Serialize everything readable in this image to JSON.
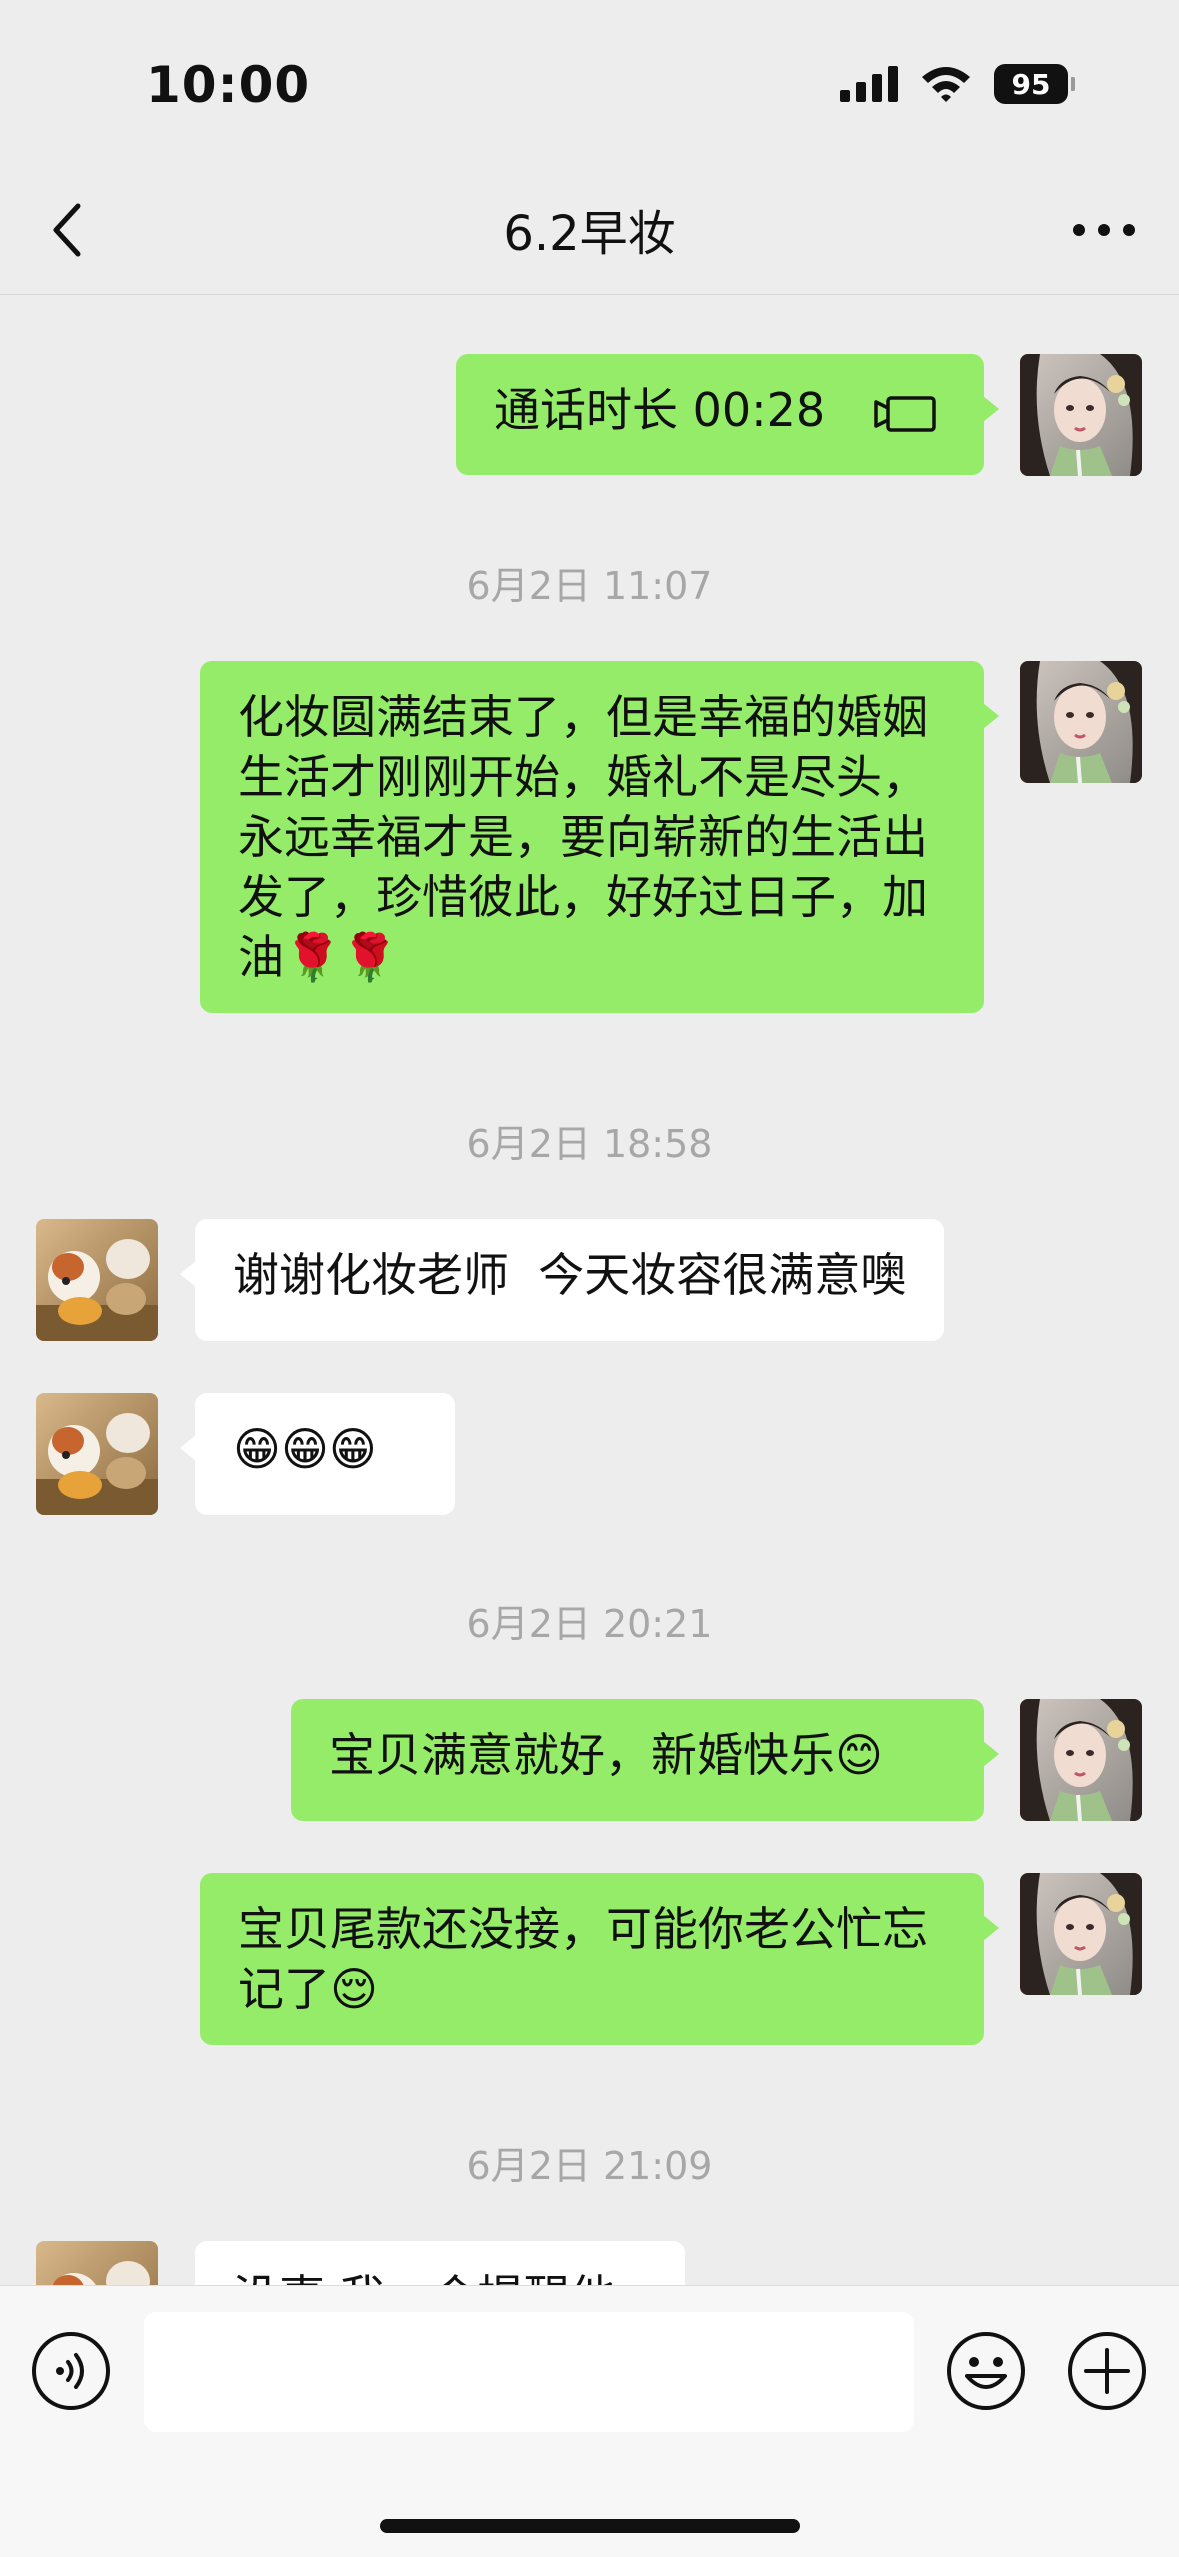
{
  "status_bar": {
    "time": "10:00",
    "battery_level": "95"
  },
  "header": {
    "title": "6.2早妆"
  },
  "messages": [
    {
      "type": "call",
      "sender": "me",
      "text": "通话时长 00:28"
    },
    {
      "type": "timestamp",
      "text": "6月2日 11:07"
    },
    {
      "type": "text",
      "sender": "me",
      "text": "化妆圆满结束了，但是幸福的婚姻生活才刚刚开始，婚礼不是尽头，永远幸福才是，要向崭新的生活出发了，珍惜彼此，好好过日子，加油🌹🌹"
    },
    {
      "type": "timestamp",
      "text": "6月2日 18:58"
    },
    {
      "type": "text",
      "sender": "other",
      "text": "谢谢化妆老师  今天妆容很满意噢"
    },
    {
      "type": "text",
      "sender": "other",
      "text": "😁😁😁"
    },
    {
      "type": "timestamp",
      "text": "6月2日 20:21"
    },
    {
      "type": "text",
      "sender": "me",
      "text": "宝贝满意就好，新婚快乐😊"
    },
    {
      "type": "text",
      "sender": "me",
      "text": "宝贝尾款还没接，可能你老公忙忘记了😌"
    },
    {
      "type": "timestamp",
      "text": "6月2日 21:09"
    },
    {
      "type": "text",
      "sender": "other",
      "text": "没事 我一会提醒他"
    }
  ],
  "input_bar": {
    "placeholder": ""
  },
  "colors": {
    "my_bubble": "#95ec69",
    "other_bubble": "#ffffff",
    "background": "#ededed"
  },
  "icons": [
    "back-icon",
    "more-icon",
    "voice-icon",
    "emoji-icon",
    "plus-icon",
    "video-call-icon",
    "signal-icon",
    "wifi-icon",
    "battery-icon"
  ]
}
